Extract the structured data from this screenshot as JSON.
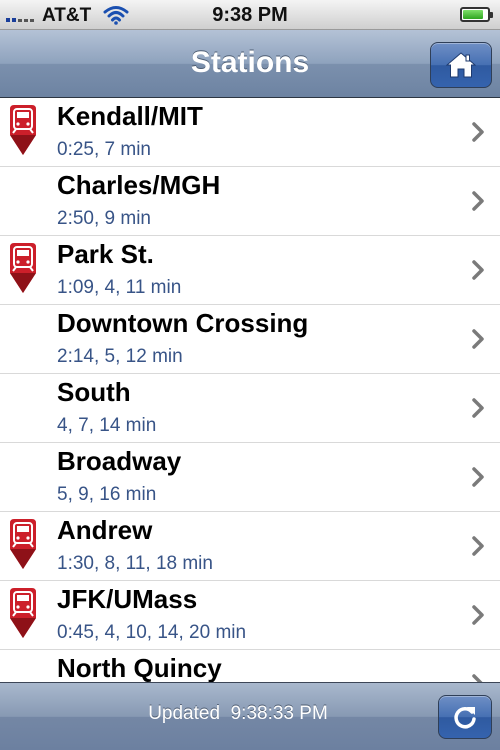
{
  "status_bar": {
    "carrier": "AT&T",
    "time": "9:38 PM",
    "battery_level": 0.85,
    "signal_icon": "signal-bars-icon",
    "wifi_icon": "wifi-icon",
    "battery_icon": "battery-icon"
  },
  "nav": {
    "title": "Stations",
    "home_icon": "home-icon"
  },
  "colors": {
    "t_red": "#cc1f2a",
    "time_blue": "#385487",
    "bar_blue": "#3563ae"
  },
  "stations": [
    {
      "name": "Kendall/MIT",
      "times": "0:25, 7 min",
      "t_icon": true
    },
    {
      "name": "Charles/MGH",
      "times": "2:50, 9 min",
      "t_icon": false
    },
    {
      "name": "Park St.",
      "times": "1:09, 4, 11 min",
      "t_icon": true
    },
    {
      "name": "Downtown Crossing",
      "times": "2:14, 5, 12 min",
      "t_icon": false
    },
    {
      "name": "South",
      "times": "4, 7, 14 min",
      "t_icon": false
    },
    {
      "name": "Broadway",
      "times": "5, 9, 16 min",
      "t_icon": false
    },
    {
      "name": "Andrew",
      "times": "1:30, 8, 11, 18 min",
      "t_icon": true
    },
    {
      "name": "JFK/UMass",
      "times": "0:45, 4, 10, 14, 20 min",
      "t_icon": true
    },
    {
      "name": "North Quincy",
      "times": "",
      "t_icon": false
    }
  ],
  "toolbar": {
    "updated_label": "Updated",
    "updated_time": "9:38:33 PM",
    "refresh_icon": "refresh-icon"
  }
}
